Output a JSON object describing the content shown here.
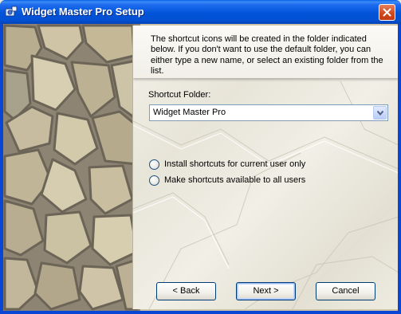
{
  "window": {
    "title": "Widget Master Pro Setup"
  },
  "content": {
    "instructions": "The shortcut icons will be created in the folder indicated below. If you don't want to use the default folder, you can either type a new name, or select an existing folder from the list.",
    "folder_label": "Shortcut Folder:",
    "folder_value": "Widget Master Pro",
    "radio_options": [
      {
        "label": "Install shortcuts for current user only",
        "selected": false
      },
      {
        "label": "Make shortcuts available to all users",
        "selected": false
      }
    ]
  },
  "buttons": {
    "back": "< Back",
    "next": "Next >",
    "cancel": "Cancel"
  },
  "colors": {
    "titlebar": "#0354d9",
    "close_button": "#d14a1f",
    "paper": "#efede5"
  }
}
